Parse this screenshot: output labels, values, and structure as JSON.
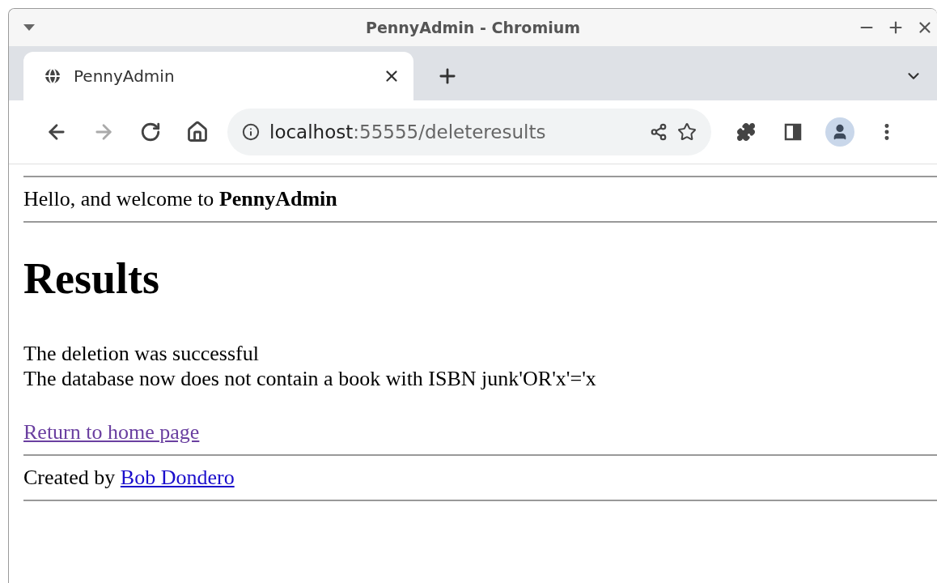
{
  "window": {
    "title": "PennyAdmin - Chromium"
  },
  "tabs": [
    {
      "title": "PennyAdmin",
      "selected": true
    }
  ],
  "address_bar": {
    "host": "localhost",
    "path": ":55555/deleteresults"
  },
  "page": {
    "welcome": "Hello, and welcome to **PennyAdmin**",
    "heading": "Results",
    "messages": [
      "The deletion was successful",
      "The database now does not contain a book with ISBN junk'OR'x'='x"
    ],
    "return_link": {
      "text": "Return to home page",
      "visited": true
    },
    "footer": {
      "text": "Created by",
      "link": {
        "text": "Bob Dondero",
        "visited": false
      }
    }
  }
}
